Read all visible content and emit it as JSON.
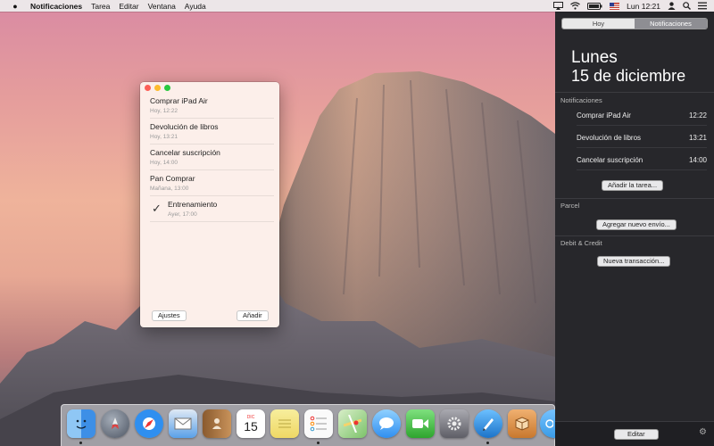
{
  "menubar": {
    "apple_icon": "apple-icon",
    "app_name": "Notificaciones",
    "menus": [
      "Tarea",
      "Editar",
      "Ventana",
      "Ayuda"
    ],
    "clock": "Lun 12:21"
  },
  "window": {
    "tasks": [
      {
        "title": "Comprar iPad Air",
        "due": "Hoy, 12:22",
        "done": false
      },
      {
        "title": "Devolución de libros",
        "due": "Hoy, 13:21",
        "done": false
      },
      {
        "title": "Cancelar suscripción",
        "due": "Hoy, 14:00",
        "done": false
      },
      {
        "title": "Pan Comprar",
        "due": "Mañana, 13:00",
        "done": false
      },
      {
        "title": "Entrenamiento",
        "due": "Ayer, 17:00",
        "done": true
      }
    ],
    "check_mark": "✓",
    "settings_label": "Ajustes",
    "add_label": "Añadir"
  },
  "notification_center": {
    "tabs": [
      "Hoy",
      "Notificaciones"
    ],
    "active_tab": "Notificaciones",
    "day_name": "Lunes",
    "date": "15 de diciembre",
    "sections": {
      "notificaciones": {
        "label": "Notificaciones",
        "items": [
          {
            "title": "Comprar iPad Air",
            "time": "12:22"
          },
          {
            "title": "Devolución de libros",
            "time": "13:21"
          },
          {
            "title": "Cancelar suscripción",
            "time": "14:00"
          }
        ],
        "button": "Añadir la tarea..."
      },
      "parcel": {
        "label": "Parcel",
        "button": "Agregar nuevo envío..."
      },
      "debit": {
        "label": "Debit & Credit",
        "button": "Nueva transacción..."
      }
    },
    "edit_label": "Editar"
  },
  "dock": {
    "apps": [
      {
        "name": "finder-icon",
        "color": "#3d8fe6"
      },
      {
        "name": "launchpad-icon",
        "color": "#6c7584"
      },
      {
        "name": "safari-icon",
        "color": "#2f8ff0"
      },
      {
        "name": "mail-icon",
        "color": "#5aa0e8"
      },
      {
        "name": "contacts-icon",
        "color": "#b07a44"
      },
      {
        "name": "calendar-icon",
        "color": "#ffffff"
      },
      {
        "name": "notes-icon",
        "color": "#f3e27a"
      },
      {
        "name": "reminders-icon",
        "color": "#f8f8f8"
      },
      {
        "name": "maps-icon",
        "color": "#7cc36a"
      },
      {
        "name": "messages-icon",
        "color": "#4aa8f5"
      },
      {
        "name": "facetime-icon",
        "color": "#48c148"
      },
      {
        "name": "system-preferences-icon",
        "color": "#8b8b92"
      },
      {
        "name": "pencil-app-icon",
        "color": "#2a8cdc"
      },
      {
        "name": "package-app-icon",
        "color": "#d58b3e"
      },
      {
        "name": "sync-app-icon",
        "color": "#3a9be6"
      }
    ],
    "calendar_month": "DIC",
    "calendar_day": "15"
  }
}
